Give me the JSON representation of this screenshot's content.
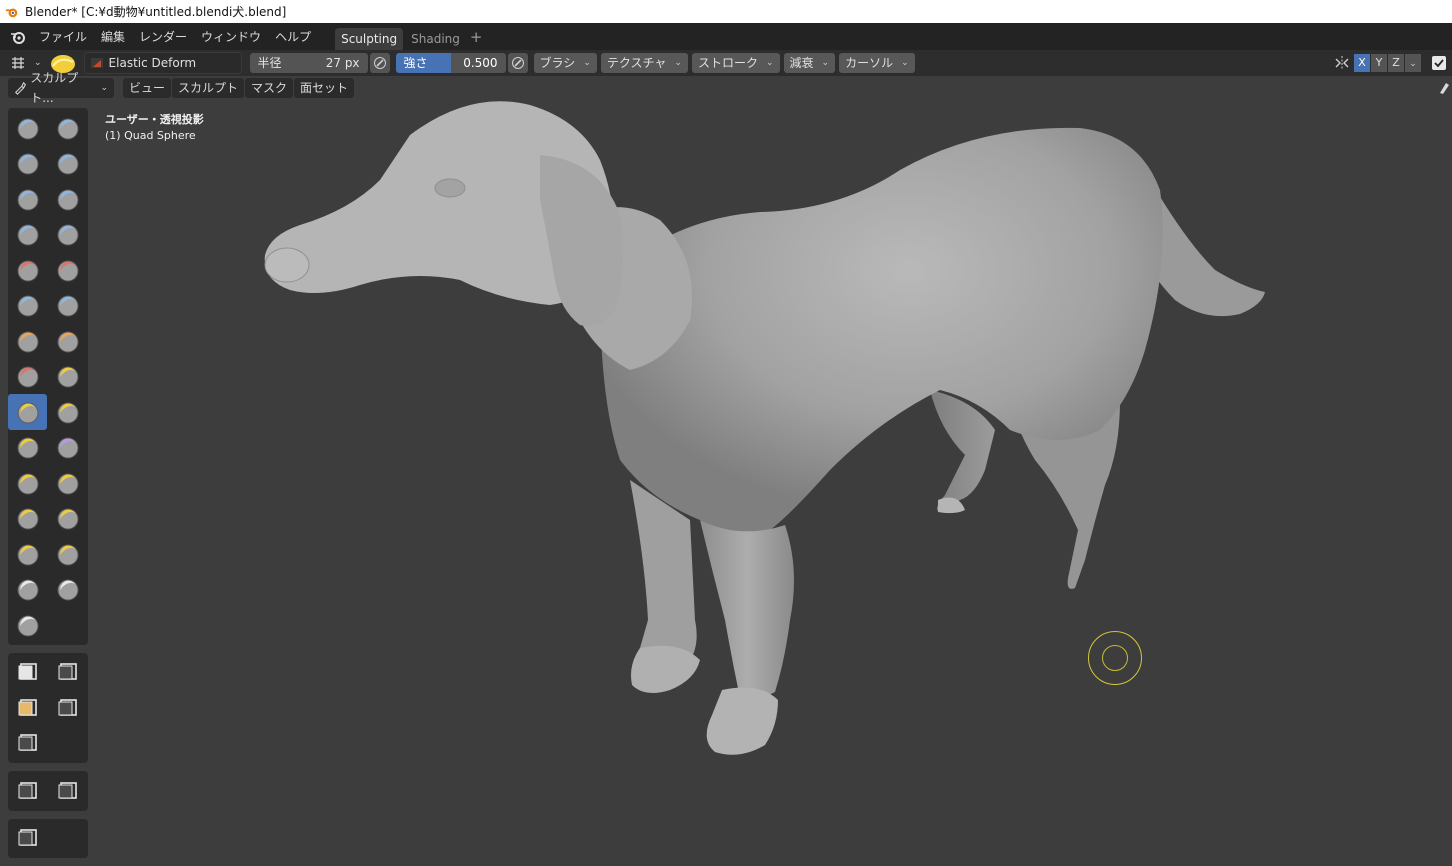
{
  "window": {
    "title": "Blender* [C:¥d動物¥untitled.blendi犬.blend]"
  },
  "menu": {
    "items": [
      "ファイル",
      "編集",
      "レンダー",
      "ウィンドウ",
      "ヘルプ"
    ],
    "workspaces": [
      "Sculpting",
      "Shading"
    ],
    "active_workspace": "Sculpting",
    "add_workspace": "+"
  },
  "tool_header": {
    "brush_name": "Elastic Deform",
    "radius_label": "半径",
    "radius_value": "27 px",
    "strength_label": "強さ",
    "strength_value": "0.500",
    "strength_fraction": 0.5,
    "dropdowns": [
      "ブラシ",
      "テクスチャ",
      "ストローク",
      "減衰",
      "カーソル"
    ],
    "axes": [
      "X",
      "Y",
      "Z"
    ],
    "active_axis": "X"
  },
  "mode_header": {
    "mode": "スカルプト...",
    "menus": [
      "ビュー",
      "スカルプト",
      "マスク",
      "面セット"
    ]
  },
  "viewport": {
    "view_title": "ユーザー・透視投影",
    "object_name": "(1) Quad Sphere"
  },
  "colors": {
    "accent": "#4772b3",
    "viewport_bg": "#3d3d3d",
    "header_bg": "#2d2d2d",
    "brush_cursor": "#d4c83a"
  },
  "toolbar": {
    "active_tool": "elastic-deform",
    "sculpt_tools": [
      "draw",
      "draw-sharp",
      "clay",
      "clay-strips",
      "clay-thumb",
      "layer",
      "inflate",
      "blob",
      "crease",
      "smooth",
      "flatten",
      "fill",
      "scrape",
      "multiplane-scrape",
      "pinch",
      "grab",
      "elastic-deform",
      "snake-hook",
      "thumb",
      "pose",
      "nudge",
      "rotate",
      "slide-relax",
      "boundary",
      "cloth",
      "simplify",
      "mask",
      "draw-face-sets",
      "multires-displacement"
    ],
    "mask_tools": [
      "box-mask",
      "box-hide",
      "box-face-set",
      "box-trim",
      "line-project"
    ],
    "filter_tools": [
      "mesh-filter",
      "cloth-filter"
    ],
    "misc_tools": [
      "color-filter"
    ]
  }
}
